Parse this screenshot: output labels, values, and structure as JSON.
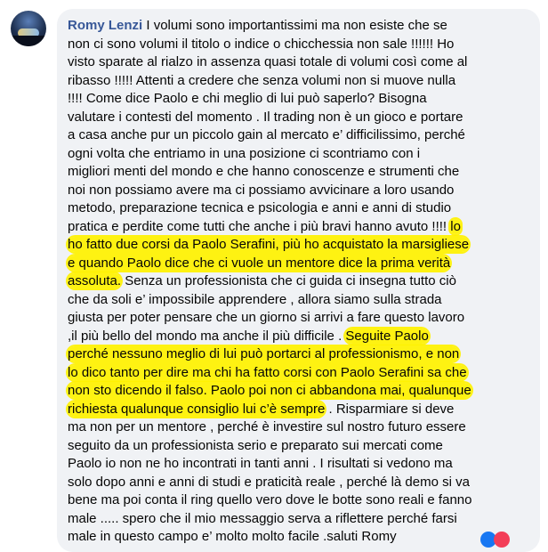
{
  "comment": {
    "author": "Romy Lenzi",
    "lines": [
      [
        " I volumi sono importantissimi ma non esiste che se"
      ],
      [
        "non ci sono volumi il titolo o indice o chicchessia non sale !!!!!! Ho"
      ],
      [
        "visto sparate al rialzo in assenza quasi totale di volumi così come al"
      ],
      [
        "ribasso !!!!! Attenti a credere che senza volumi non si muove nulla"
      ],
      [
        "!!!! Come dice Paolo e chi meglio di lui può saperlo? Bisogna"
      ],
      [
        "valutare i contesti del momento . Il trading non è un gioco e portare"
      ],
      [
        "a casa anche pur un piccolo gain al mercato e’ difficilissimo, perché"
      ],
      [
        "ogni volta che entriamo in una posizione ci scontriamo con i"
      ],
      [
        "migliori menti del mondo e che hanno conoscenze e strumenti che"
      ],
      [
        "noi non possiamo avere ma ci possiamo avvicinare a loro usando"
      ],
      [
        "metodo, preparazione tecnica e psicologia e anni e anni di studio"
      ],
      [
        "pratica e perdite come tutti che anche i più bravi hanno avuto !!!! ",
        "lo"
      ],
      [
        "",
        "ho fatto due corsi da Paolo Serafini, più ho acquistato la marsigliese"
      ],
      [
        "",
        "e quando Paolo dice che ci vuole un mentore dice la prima verità"
      ],
      [
        "",
        "assoluta.",
        " Senza un professionista che ci guida ci insegna tutto ciò"
      ],
      [
        "che da soli e’ impossibile apprendere , allora siamo sulla strada"
      ],
      [
        "giusta per poter pensare che un giorno si arrivi a fare questo lavoro"
      ],
      [
        ",il più bello del mondo ma anche il più difficile . ",
        "Seguite Paolo"
      ],
      [
        "",
        "perché nessuno meglio di lui può portarci al professionismo, e non"
      ],
      [
        "",
        "lo dico tanto per dire ma chi ha fatto corsi con Paolo Serafini sa che"
      ],
      [
        "",
        "non sto dicendo il falso. Paolo poi non ci abbandona mai, qualunque"
      ],
      [
        "",
        "richiesta qualunque consiglio lui c’è sempre",
        " . Risparmiare si deve"
      ],
      [
        "ma non per un mentore , perché è investire sul nostro futuro essere"
      ],
      [
        "seguito da un professionista serio e preparato sui mercati come"
      ],
      [
        "Paolo io non ne ho incontrati in tanti anni . I risultati si vedono ma"
      ],
      [
        "solo dopo anni e anni di studi e praticità reale , perché là demo si va"
      ],
      [
        "bene ma poi conta il ring quello vero dove le botte sono reali e fanno"
      ],
      [
        "male ..... spero che il mio messaggio serva a riflettere perché farsi"
      ],
      [
        "male in questo campo e’ molto molto facile .saluti Romy"
      ]
    ]
  },
  "icons": {
    "avatar": "avatar-photo",
    "options": "more-options-icon",
    "reactions": [
      "like-reaction-icon",
      "love-reaction-icon"
    ]
  },
  "colors": {
    "author": "#385898",
    "highlight": "#fff200",
    "bubble": "#f0f2f5"
  }
}
